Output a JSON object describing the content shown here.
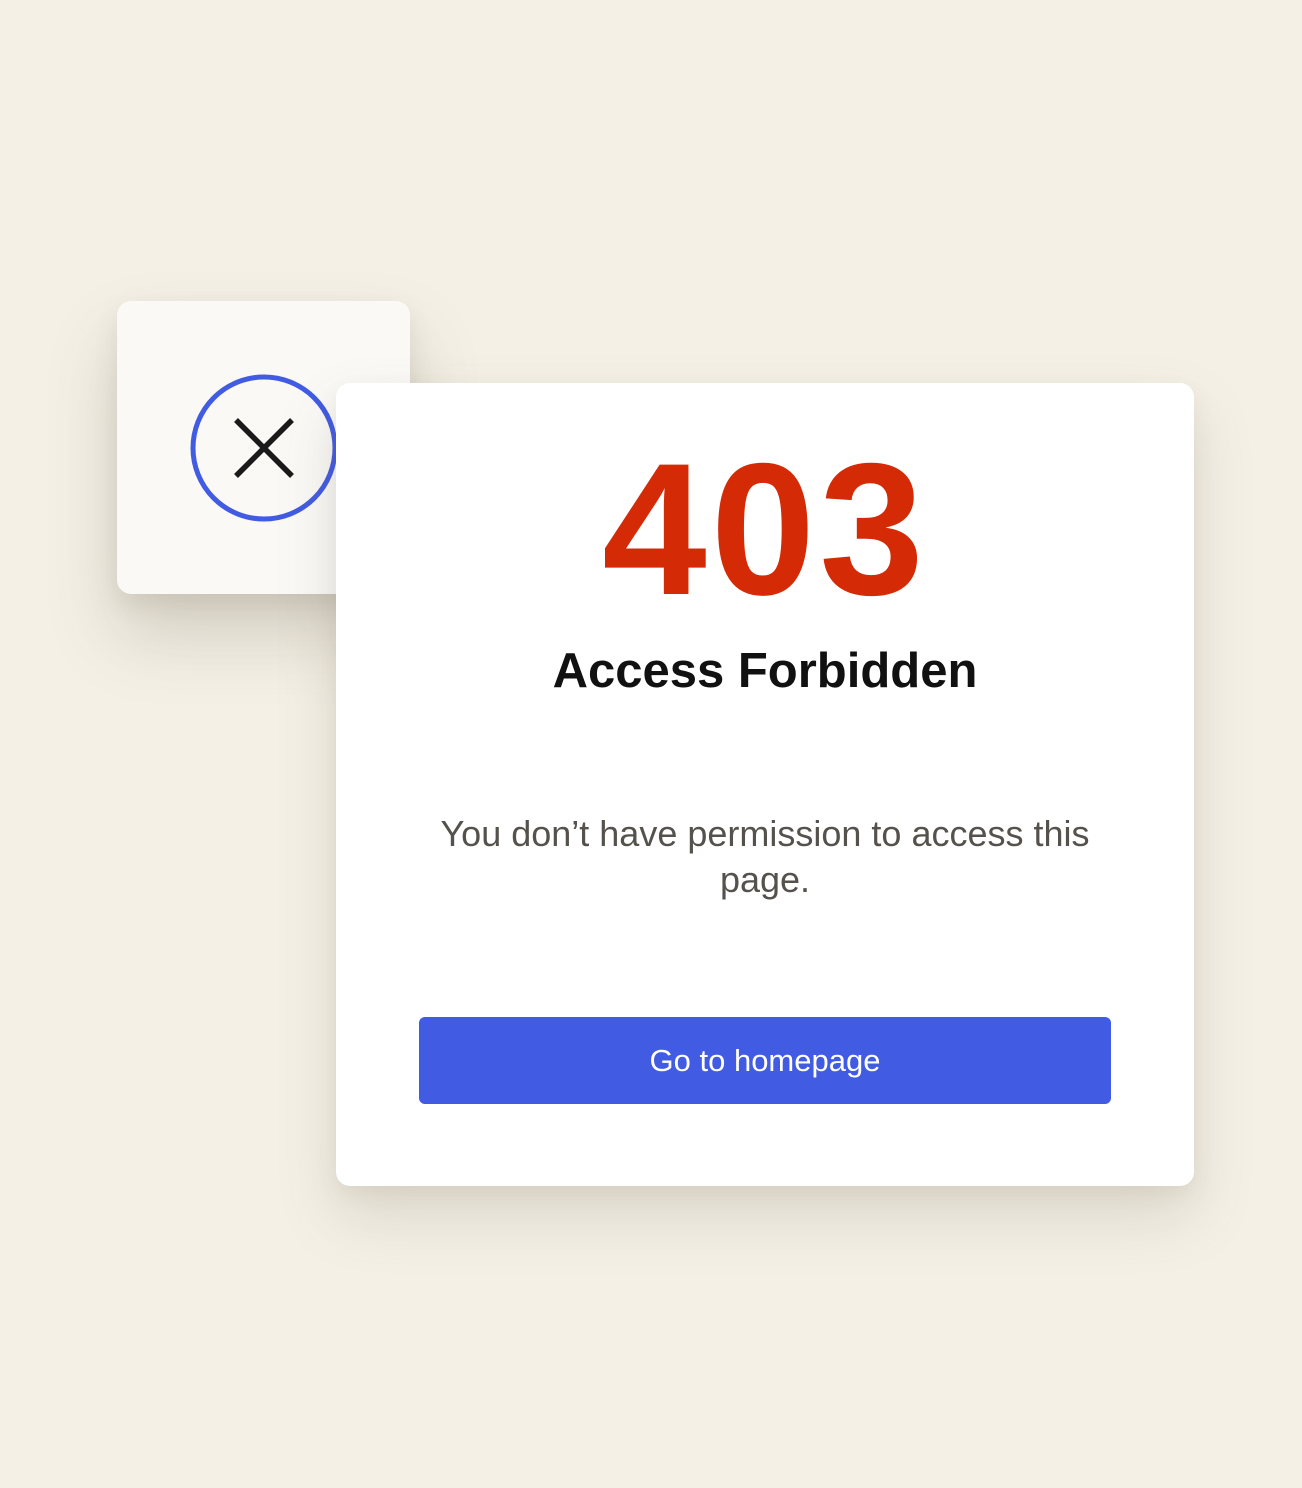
{
  "colors": {
    "background": "#f4f0e6",
    "card": "#ffffff",
    "icon_tile": "#faf9f6",
    "error_code": "#d42b06",
    "accent": "#415be3",
    "title": "#111111",
    "message": "#55524d"
  },
  "icon": {
    "name": "close-circle-icon"
  },
  "error": {
    "code": "403",
    "title": "Access Forbidden",
    "message": "You don’t have permission to access this page."
  },
  "actions": {
    "home_label": "Go to homepage"
  }
}
